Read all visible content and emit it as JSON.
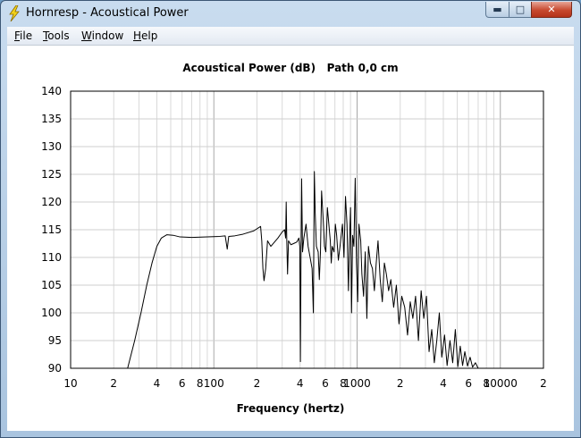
{
  "window": {
    "title": "Hornresp - Acoustical Power"
  },
  "menu": [
    {
      "key": "F",
      "rest": "ile"
    },
    {
      "key": "T",
      "rest": "ools"
    },
    {
      "key": "W",
      "rest": "indow"
    },
    {
      "key": "H",
      "rest": "elp"
    }
  ],
  "icons": {
    "app": "lightning-icon",
    "minimize": "minimize-icon",
    "maximize": "maximize-icon",
    "close": "close-icon"
  },
  "chart_data": {
    "type": "line",
    "title": "Acoustical Power (dB)   Path 0,0 cm",
    "xlabel": "Frequency (hertz)",
    "ylabel": "",
    "x_scale": "log",
    "xlim": [
      10,
      20000
    ],
    "ylim": [
      90,
      140
    ],
    "y_ticks": [
      140,
      135,
      130,
      125,
      120,
      115,
      110,
      105,
      100,
      95,
      90
    ],
    "x_ticks": [
      {
        "value": 10,
        "label": "10"
      },
      {
        "value": 20,
        "label": "2"
      },
      {
        "value": 40,
        "label": "4"
      },
      {
        "value": 60,
        "label": "6"
      },
      {
        "value": 80,
        "label": "8"
      },
      {
        "value": 100,
        "label": "100"
      },
      {
        "value": 200,
        "label": "2"
      },
      {
        "value": 400,
        "label": "4"
      },
      {
        "value": 600,
        "label": "6"
      },
      {
        "value": 800,
        "label": "8"
      },
      {
        "value": 1000,
        "label": "1000"
      },
      {
        "value": 2000,
        "label": "2"
      },
      {
        "value": 4000,
        "label": "4"
      },
      {
        "value": 6000,
        "label": "6"
      },
      {
        "value": 8000,
        "label": "8"
      },
      {
        "value": 10000,
        "label": "10000"
      },
      {
        "value": 20000,
        "label": "2"
      }
    ],
    "grid": true,
    "series": [
      {
        "color": "#000000",
        "points": [
          [
            25,
            90
          ],
          [
            28,
            95
          ],
          [
            31,
            100
          ],
          [
            34,
            105
          ],
          [
            37,
            109
          ],
          [
            40,
            112
          ],
          [
            43,
            113.5
          ],
          [
            47,
            114.1
          ],
          [
            52,
            114
          ],
          [
            58,
            113.7
          ],
          [
            70,
            113.6
          ],
          [
            90,
            113.7
          ],
          [
            110,
            113.8
          ],
          [
            120,
            113.9
          ],
          [
            124,
            111.5
          ],
          [
            127,
            113.8
          ],
          [
            140,
            113.9
          ],
          [
            160,
            114.2
          ],
          [
            190,
            114.8
          ],
          [
            212,
            115.6
          ],
          [
            216,
            113
          ],
          [
            220,
            108
          ],
          [
            224,
            105.8
          ],
          [
            230,
            108
          ],
          [
            237,
            113
          ],
          [
            250,
            112
          ],
          [
            280,
            113.5
          ],
          [
            300,
            114.6
          ],
          [
            312,
            115
          ],
          [
            317,
            113.5
          ],
          [
            320,
            120
          ],
          [
            323,
            113
          ],
          [
            327,
            107
          ],
          [
            332,
            113
          ],
          [
            345,
            112.3
          ],
          [
            360,
            112.5
          ],
          [
            380,
            112.8
          ],
          [
            392,
            113.5
          ],
          [
            398,
            112
          ],
          [
            402,
            91.2
          ],
          [
            406,
            110
          ],
          [
            410,
            124.2
          ],
          [
            416,
            111
          ],
          [
            425,
            113.5
          ],
          [
            440,
            116
          ],
          [
            455,
            112
          ],
          [
            470,
            110
          ],
          [
            485,
            108
          ],
          [
            495,
            100
          ],
          [
            500,
            117
          ],
          [
            503,
            125.5
          ],
          [
            510,
            118
          ],
          [
            520,
            112
          ],
          [
            535,
            111
          ],
          [
            545,
            106
          ],
          [
            555,
            111
          ],
          [
            565,
            122
          ],
          [
            578,
            117.5
          ],
          [
            592,
            112
          ],
          [
            605,
            111
          ],
          [
            620,
            119
          ],
          [
            630,
            117
          ],
          [
            650,
            113
          ],
          [
            660,
            109
          ],
          [
            670,
            112
          ],
          [
            690,
            111
          ],
          [
            705,
            116
          ],
          [
            720,
            114
          ],
          [
            740,
            109.5
          ],
          [
            760,
            112
          ],
          [
            790,
            116
          ],
          [
            810,
            110
          ],
          [
            830,
            121
          ],
          [
            850,
            116
          ],
          [
            870,
            104
          ],
          [
            885,
            113
          ],
          [
            900,
            119
          ],
          [
            915,
            100
          ],
          [
            930,
            114
          ],
          [
            950,
            112
          ],
          [
            970,
            124.3
          ],
          [
            990,
            109
          ],
          [
            1010,
            102
          ],
          [
            1030,
            116
          ],
          [
            1060,
            113
          ],
          [
            1080,
            107
          ],
          [
            1110,
            103
          ],
          [
            1140,
            111
          ],
          [
            1170,
            99
          ],
          [
            1200,
            112
          ],
          [
            1240,
            109
          ],
          [
            1280,
            108
          ],
          [
            1320,
            104
          ],
          [
            1360,
            109
          ],
          [
            1400,
            113
          ],
          [
            1450,
            106
          ],
          [
            1500,
            102
          ],
          [
            1550,
            109
          ],
          [
            1600,
            107
          ],
          [
            1660,
            104
          ],
          [
            1720,
            106
          ],
          [
            1800,
            101
          ],
          [
            1880,
            105
          ],
          [
            1960,
            98
          ],
          [
            2050,
            103
          ],
          [
            2150,
            101
          ],
          [
            2250,
            96
          ],
          [
            2350,
            102
          ],
          [
            2450,
            99
          ],
          [
            2560,
            103
          ],
          [
            2680,
            95
          ],
          [
            2800,
            104
          ],
          [
            2920,
            99
          ],
          [
            3050,
            103
          ],
          [
            3180,
            93
          ],
          [
            3320,
            97
          ],
          [
            3460,
            91
          ],
          [
            3600,
            95
          ],
          [
            3750,
            100
          ],
          [
            3900,
            92
          ],
          [
            4080,
            96
          ],
          [
            4250,
            90.5
          ],
          [
            4450,
            95
          ],
          [
            4650,
            91
          ],
          [
            4850,
            97
          ],
          [
            5050,
            90.3
          ],
          [
            5250,
            94
          ],
          [
            5450,
            90.5
          ],
          [
            5650,
            93
          ],
          [
            5900,
            90.4
          ],
          [
            6150,
            92
          ],
          [
            6400,
            90.2
          ],
          [
            6700,
            91
          ],
          [
            7000,
            90
          ]
        ]
      }
    ]
  }
}
